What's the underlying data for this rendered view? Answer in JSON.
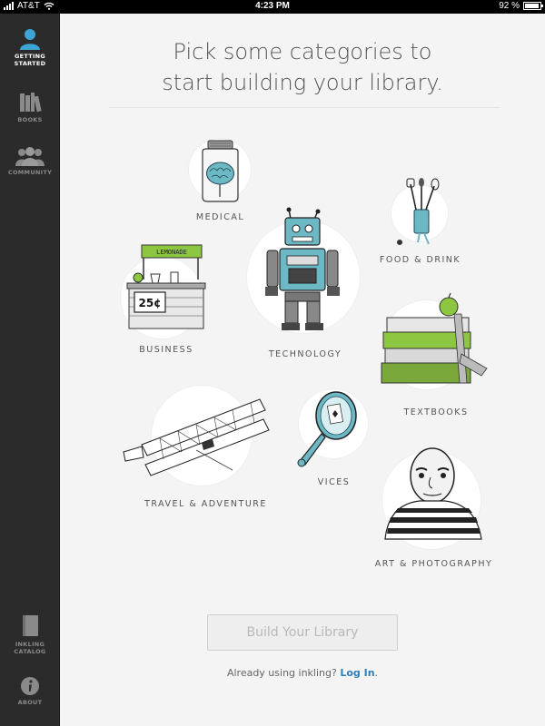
{
  "status_bar": {
    "carrier": "AT&T",
    "time": "4:23 PM",
    "battery": "92 %",
    "battery_level": 0.92
  },
  "sidebar": {
    "items": [
      {
        "label": "GETTING STARTED",
        "icon": "person-icon",
        "active": true
      },
      {
        "label": "BOOKS",
        "icon": "books-icon",
        "active": false
      },
      {
        "label": "COMMUNITY",
        "icon": "community-icon",
        "active": false
      }
    ],
    "bottom_items": [
      {
        "label": "INKLING CATALOG",
        "icon": "catalog-book-icon"
      },
      {
        "label": "ABOUT",
        "icon": "info-icon"
      }
    ]
  },
  "headline": {
    "line1": "Pick some categories to",
    "line2": "start building your library."
  },
  "categories": [
    {
      "id": "medical",
      "label": "MEDICAL",
      "icon": "brain-jar-icon"
    },
    {
      "id": "food",
      "label": "FOOD & DRINK",
      "icon": "kitchen-utensils-icon"
    },
    {
      "id": "technology",
      "label": "TECHNOLOGY",
      "icon": "robot-icon"
    },
    {
      "id": "business",
      "label": "BUSINESS",
      "icon": "lemonade-stand-icon"
    },
    {
      "id": "textbooks",
      "label": "TEXTBOOKS",
      "icon": "book-stack-apple-icon"
    },
    {
      "id": "travel",
      "label": "TRAVEL & ADVENTURE",
      "icon": "biplane-icon"
    },
    {
      "id": "vices",
      "label": "VICES",
      "icon": "hand-mirror-icon"
    },
    {
      "id": "art",
      "label": "ART & PHOTOGRAPHY",
      "icon": "artist-portrait-icon"
    }
  ],
  "business_sign": "LEMONADE",
  "business_price": "25¢",
  "build_button": "Build Your Library",
  "login": {
    "prompt": "Already using inkling?",
    "link": "Log In",
    "suffix": "."
  },
  "colors": {
    "sidebar": "#2b2b2b",
    "accent": "#3da4d6",
    "link": "#2c7fb8",
    "teal": "#6cb8c4",
    "green": "#8dc641"
  }
}
